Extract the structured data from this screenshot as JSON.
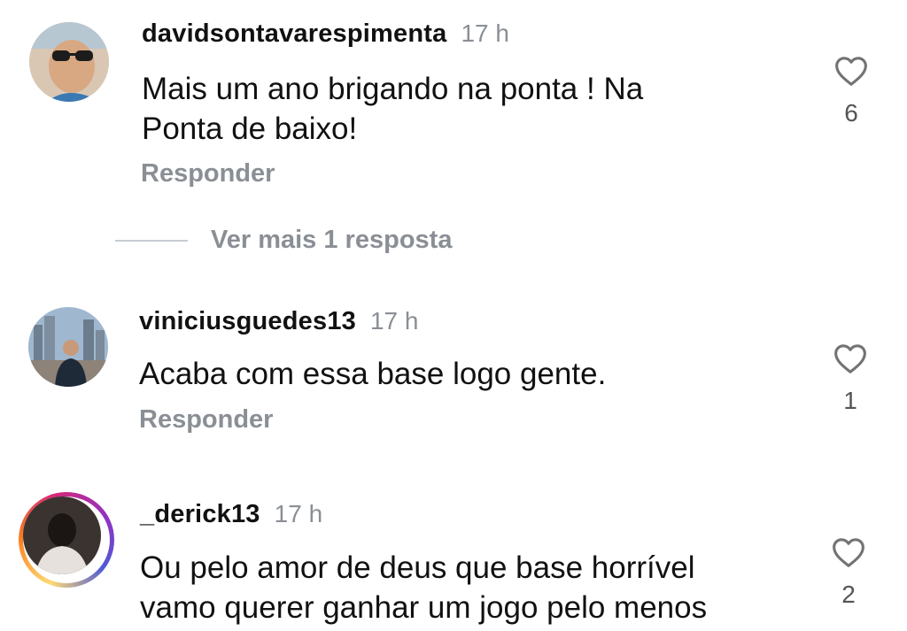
{
  "comments": [
    {
      "username": "davidsontavarespimenta",
      "time": "17 h",
      "text_lines": [
        "Mais um ano brigando na ponta ! Na",
        "Ponta de baixo!"
      ],
      "reply_label": "Responder",
      "likes": "6"
    },
    {
      "username": "viniciusguedes13",
      "time": "17 h",
      "text_lines": [
        "Acaba com essa base logo gente."
      ],
      "reply_label": "Responder",
      "likes": "1"
    },
    {
      "username": "_derick13",
      "time": "17 h",
      "text_lines": [
        "Ou pelo amor de deus que base horrível",
        "vamo querer ganhar um jogo pelo menos"
      ],
      "likes": "2"
    }
  ],
  "view_more_replies": "Ver mais 1 resposta",
  "icons": {
    "like": "heart-outline-icon"
  },
  "colors": {
    "text": "#111111",
    "muted": "#8a8f95",
    "story_ring": [
      "#feda75",
      "#fa7e1e",
      "#d62976",
      "#962fbf",
      "#4f5bd5"
    ]
  }
}
